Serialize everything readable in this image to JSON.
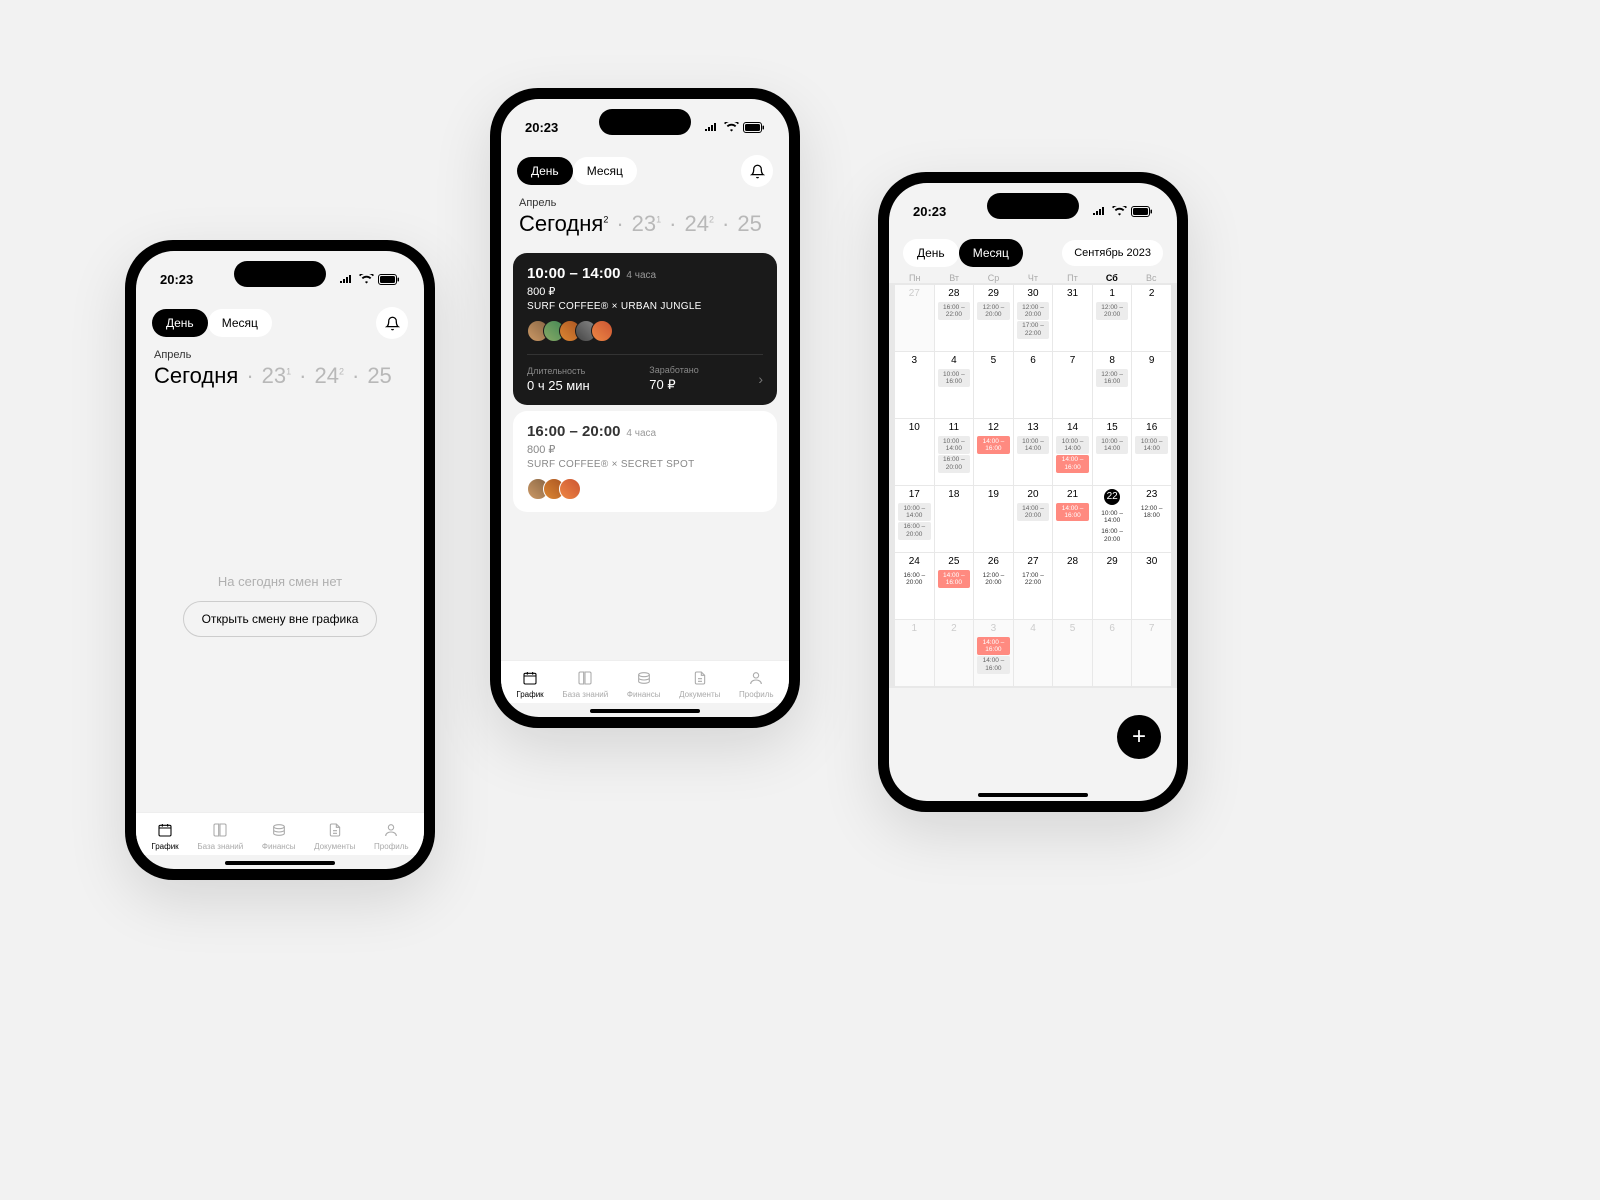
{
  "status": {
    "time": "20:23"
  },
  "toggle": {
    "day": "День",
    "month": "Месяц"
  },
  "phone1": {
    "month": "Апрель",
    "today": "Сегодня",
    "d23": "23",
    "d23s": "1",
    "d24": "24",
    "d24s": "2",
    "d25": "25",
    "empty": "На сегодня смен нет",
    "cta": "Открыть смену вне графика"
  },
  "phone2": {
    "month": "Апрель",
    "today": "Сегодня",
    "today_s": "2",
    "d23": "23",
    "d23s": "1",
    "d24": "24",
    "d24s": "2",
    "d25": "25",
    "shift1": {
      "time": "10:00 – 14:00",
      "dur": "4 часа",
      "pay": "800 ₽",
      "loc": "SURF COFFEE® × URBAN JUNGLE",
      "stats": {
        "dur_label": "Длительность",
        "dur_val": "0 ч 25 мин",
        "earn_label": "Заработано",
        "earn_val": "70 ₽"
      }
    },
    "shift2": {
      "time": "16:00 – 20:00",
      "dur": "4 часа",
      "pay": "800 ₽",
      "loc": "SURF COFFEE® × SECRET SPOT"
    }
  },
  "phone3": {
    "month_label": "Сентябрь 2023",
    "dow": [
      "Пн",
      "Вт",
      "Ср",
      "Чт",
      "Пт",
      "Сб",
      "Вс"
    ],
    "cells": [
      {
        "d": "27",
        "inactive": true
      },
      {
        "d": "28",
        "slots": [
          {
            "t": "16:00 – 22:00",
            "c": "gray"
          }
        ]
      },
      {
        "d": "29",
        "slots": [
          {
            "t": "12:00 – 20:00",
            "c": "gray"
          }
        ]
      },
      {
        "d": "30",
        "slots": [
          {
            "t": "12:00 – 20:00",
            "c": "gray"
          },
          {
            "t": "17:00 – 22:00",
            "c": "gray"
          }
        ]
      },
      {
        "d": "31"
      },
      {
        "d": "1",
        "slots": [
          {
            "t": "12:00 – 20:00",
            "c": "gray"
          }
        ]
      },
      {
        "d": "2"
      },
      {
        "d": "3"
      },
      {
        "d": "4",
        "slots": [
          {
            "t": "10:00 – 16:00",
            "c": "gray"
          }
        ]
      },
      {
        "d": "5"
      },
      {
        "d": "6"
      },
      {
        "d": "7"
      },
      {
        "d": "8",
        "slots": [
          {
            "t": "12:00 – 16:00",
            "c": "gray"
          }
        ]
      },
      {
        "d": "9"
      },
      {
        "d": "10"
      },
      {
        "d": "11",
        "slots": [
          {
            "t": "10:00 – 14:00",
            "c": "gray"
          },
          {
            "t": "16:00 – 20:00",
            "c": "gray"
          }
        ]
      },
      {
        "d": "12",
        "slots": [
          {
            "t": "14:00 – 16:00",
            "c": "red"
          }
        ]
      },
      {
        "d": "13",
        "slots": [
          {
            "t": "10:00 – 14:00",
            "c": "gray"
          }
        ]
      },
      {
        "d": "14",
        "slots": [
          {
            "t": "10:00 – 14:00",
            "c": "gray"
          },
          {
            "t": "14:00 – 16:00",
            "c": "red"
          }
        ]
      },
      {
        "d": "15",
        "slots": [
          {
            "t": "10:00 – 14:00",
            "c": "gray"
          }
        ]
      },
      {
        "d": "16",
        "slots": [
          {
            "t": "10:00 – 14:00",
            "c": "gray"
          }
        ]
      },
      {
        "d": "17",
        "slots": [
          {
            "t": "10:00 – 14:00",
            "c": "gray"
          },
          {
            "t": "16:00 – 20:00",
            "c": "gray"
          }
        ]
      },
      {
        "d": "18"
      },
      {
        "d": "19"
      },
      {
        "d": "20",
        "slots": [
          {
            "t": "14:00 – 20:00",
            "c": "gray"
          }
        ]
      },
      {
        "d": "21",
        "slots": [
          {
            "t": "14:00 – 16:00",
            "c": "red"
          }
        ]
      },
      {
        "d": "22",
        "today": true,
        "slots": [
          {
            "t": "10:00 – 14:00",
            "c": "plain"
          },
          {
            "t": "16:00 – 20:00",
            "c": "plain"
          }
        ]
      },
      {
        "d": "23",
        "slots": [
          {
            "t": "12:00 – 18:00",
            "c": "plain"
          }
        ]
      },
      {
        "d": "24",
        "slots": [
          {
            "t": "16:00 – 20:00",
            "c": "plain"
          }
        ]
      },
      {
        "d": "25",
        "slots": [
          {
            "t": "14:00 – 16:00",
            "c": "red"
          }
        ]
      },
      {
        "d": "26",
        "slots": [
          {
            "t": "12:00 – 20:00",
            "c": "plain"
          }
        ]
      },
      {
        "d": "27",
        "slots": [
          {
            "t": "17:00 – 22:00",
            "c": "plain"
          }
        ]
      },
      {
        "d": "28"
      },
      {
        "d": "29"
      },
      {
        "d": "30"
      },
      {
        "d": "1",
        "inactive": true
      },
      {
        "d": "2",
        "inactive": true
      },
      {
        "d": "3",
        "inactive": true,
        "slots": [
          {
            "t": "14:00 – 16:00",
            "c": "red"
          },
          {
            "t": "14:00 – 16:00",
            "c": "gray"
          }
        ]
      },
      {
        "d": "4",
        "inactive": true
      },
      {
        "d": "5",
        "inactive": true
      },
      {
        "d": "6",
        "inactive": true
      },
      {
        "d": "7",
        "inactive": true
      }
    ]
  },
  "tabs": [
    "График",
    "База знаний",
    "Финансы",
    "Документы",
    "Профиль"
  ]
}
